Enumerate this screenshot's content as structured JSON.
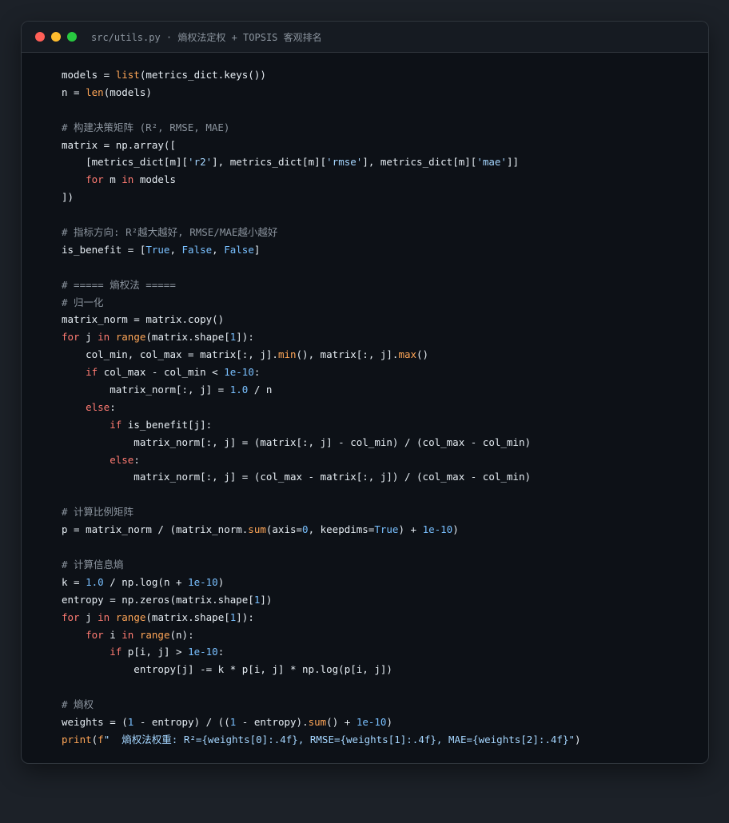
{
  "window": {
    "title": "src/utils.py · 熵权法定权 + TOPSIS 客观排名"
  },
  "code": {
    "language": "python",
    "lines": [
      "models = list(metrics_dict.keys())",
      "n = len(models)",
      "",
      "# 构建决策矩阵 (R², RMSE, MAE)",
      "matrix = np.array([",
      "    [metrics_dict[m]['r2'], metrics_dict[m]['rmse'], metrics_dict[m]['mae']]",
      "    for m in models",
      "])",
      "",
      "# 指标方向: R²越大越好, RMSE/MAE越小越好",
      "is_benefit = [True, False, False]",
      "",
      "# ===== 熵权法 =====",
      "# 归一化",
      "matrix_norm = matrix.copy()",
      "for j in range(matrix.shape[1]):",
      "    col_min, col_max = matrix[:, j].min(), matrix[:, j].max()",
      "    if col_max - col_min < 1e-10:",
      "        matrix_norm[:, j] = 1.0 / n",
      "    else:",
      "        if is_benefit[j]:",
      "            matrix_norm[:, j] = (matrix[:, j] - col_min) / (col_max - col_min)",
      "        else:",
      "            matrix_norm[:, j] = (col_max - matrix[:, j]) / (col_max - col_min)",
      "",
      "# 计算比例矩阵",
      "p = matrix_norm / (matrix_norm.sum(axis=0, keepdims=True) + 1e-10)",
      "",
      "# 计算信息熵",
      "k = 1.0 / np.log(n + 1e-10)",
      "entropy = np.zeros(matrix.shape[1])",
      "for j in range(matrix.shape[1]):",
      "    for i in range(n):",
      "        if p[i, j] > 1e-10:",
      "            entropy[j] -= k * p[i, j] * np.log(p[i, j])",
      "",
      "# 熵权",
      "weights = (1 - entropy) / ((1 - entropy).sum() + 1e-10)",
      "print(f\"  熵权法权重: R²={weights[0]:.4f}, RMSE={weights[1]:.4f}, MAE={weights[2]:.4f}\")"
    ]
  },
  "colors": {
    "page_background": "#1c2128",
    "editor_background": "#0d1117",
    "titlebar_background": "#161b22",
    "keyword": "#ff7b72",
    "function": "#ffa657",
    "number": "#79c0ff",
    "string": "#a5d6ff",
    "comment": "#8b949e",
    "text": "#e6edf3"
  },
  "icons": [
    "close-dot-icon",
    "minimize-dot-icon",
    "maximize-dot-icon"
  ]
}
